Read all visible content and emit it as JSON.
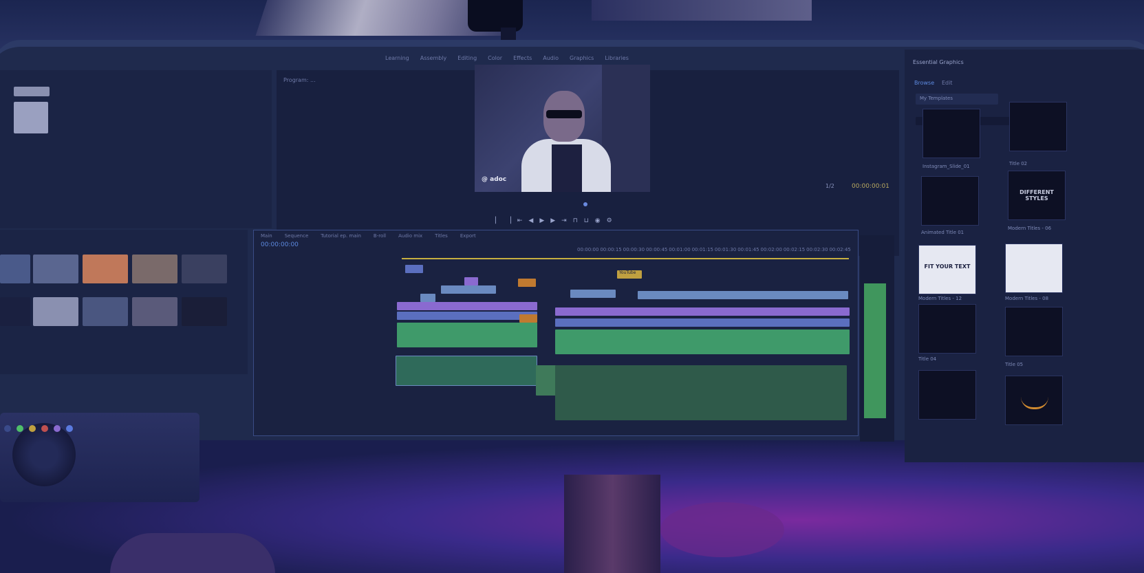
{
  "program_monitor": {
    "tab_label": "Program: ...",
    "watermark": "@ adoc",
    "fit_label": "1/2",
    "timecode": "00:00:00:01"
  },
  "menu": [
    "Learning",
    "Assembly",
    "Editing",
    "Color",
    "Effects",
    "Audio",
    "Graphics",
    "Libraries"
  ],
  "timeline": {
    "tabs": [
      "Main",
      "Sequence",
      "Tutorial ep. main",
      "B-roll",
      "Audio mix",
      "Titles",
      "Export"
    ],
    "current_time": "00:00:00:00",
    "ruler": [
      "00:00:00",
      "00:00:15",
      "00:00:30",
      "00:00:45",
      "00:01:00",
      "00:01:15",
      "00:01:30",
      "00:01:45",
      "00:02:00",
      "00:02:15",
      "00:02:30",
      "00:02:45"
    ],
    "clips": {
      "title_clip": "YouTube"
    }
  },
  "essential_graphics": {
    "panel_title": "Essential Graphics",
    "tabs": [
      "Browse",
      "Edit"
    ],
    "search_placeholder": "My Templates",
    "templates": [
      {
        "label": "Instagram_Slide_01"
      },
      {
        "label": "Title 02"
      },
      {
        "label": "Animated Title 01"
      },
      {
        "label": "Modern Titles - 06"
      },
      {
        "label": "Modern Titles - 12"
      },
      {
        "label": "Modern Titles - 08"
      },
      {
        "label": "Title 04"
      },
      {
        "label": "Title 05"
      }
    ],
    "template_texts": {
      "different": "DIFFERENT STYLES",
      "fit": "FIT YOUR TEXT"
    }
  },
  "colors": {
    "video_clip": "#5b6fbf",
    "purple_clip": "#8a6ad0",
    "audio_clip": "#3f9a6a",
    "orange_clip": "#c07a30",
    "title_clip": "#c0a040",
    "meter": "#4fbf6a"
  }
}
